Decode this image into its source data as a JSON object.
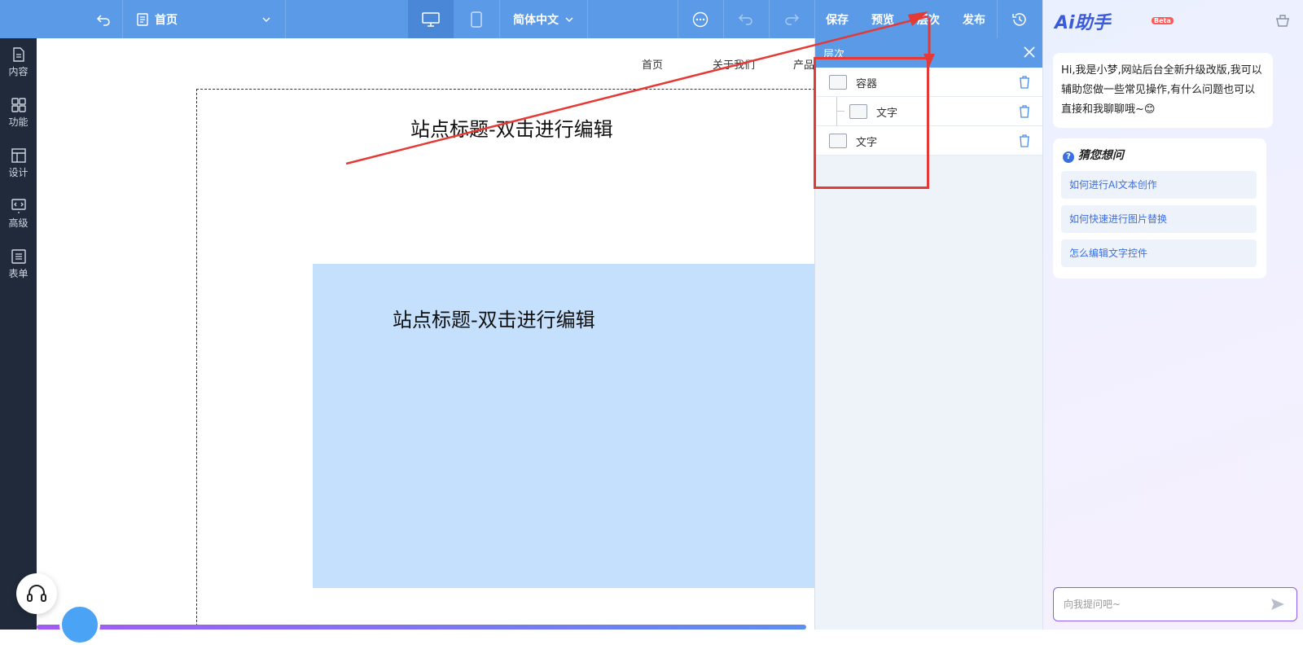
{
  "topbar": {
    "page_selector": "首页",
    "language": "简体中文",
    "save": "保存",
    "preview": "预览",
    "layers": "层次",
    "publish": "发布"
  },
  "sidebar": {
    "items": [
      {
        "label": "内容",
        "icon": "document-icon"
      },
      {
        "label": "功能",
        "icon": "grid-icon"
      },
      {
        "label": "设计",
        "icon": "layout-icon"
      },
      {
        "label": "高级",
        "icon": "code-monitor-icon"
      },
      {
        "label": "表单",
        "icon": "list-icon"
      }
    ]
  },
  "canvas": {
    "nav": [
      "首页",
      "关于我们",
      "产品"
    ],
    "site_title_1": "站点标题-双击进行编辑",
    "site_title_2": "站点标题-双击进行编辑"
  },
  "layer_panel": {
    "title": "层次",
    "rows": [
      {
        "label": "容器",
        "type": "container"
      },
      {
        "label": "文字",
        "type": "text"
      },
      {
        "label": "文字",
        "type": "text"
      }
    ]
  },
  "ai": {
    "logo": "Ai助手",
    "beta": "Beta",
    "greeting": "Hi,我是小梦,网站后台全新升级改版,我可以辅助您做一些常见操作,有什么问题也可以直接和我聊聊哦~😊",
    "guess_title": "猜您想问",
    "suggestions": [
      "如何进行AI文本创作",
      "如何快速进行图片替换",
      "怎么编辑文字控件"
    ],
    "input_placeholder": "向我提问吧~"
  },
  "colors": {
    "topbar": "#5a9ae6",
    "sidebar": "#202a3a",
    "annotation_red": "#e53935",
    "block_blue": "#c5e0fc"
  }
}
